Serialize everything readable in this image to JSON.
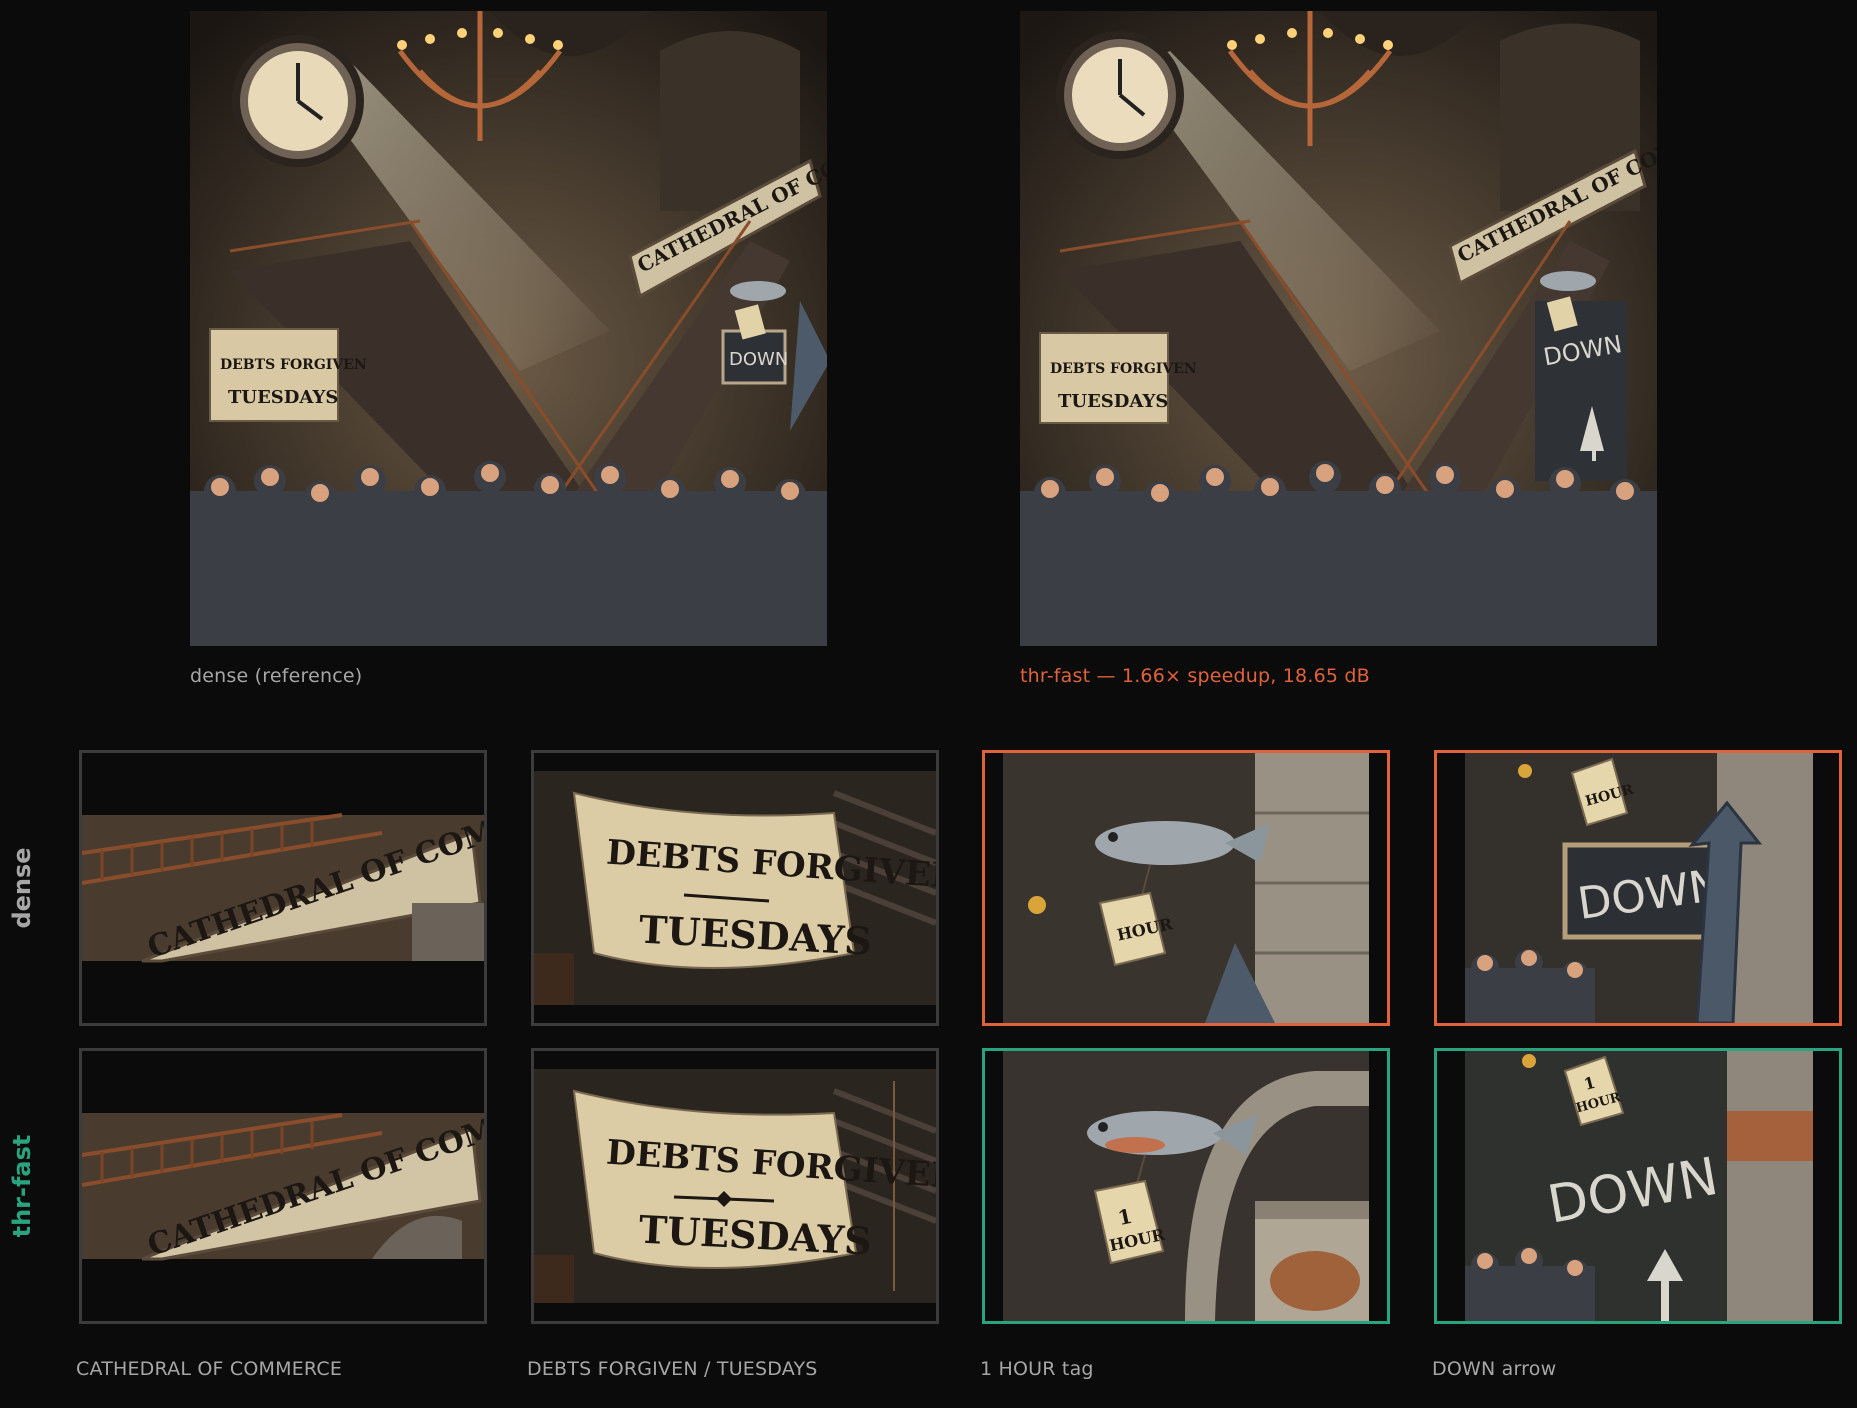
{
  "hero": {
    "left_caption": "dense (reference)",
    "right_caption": "thr-fast — 1.66× speedup, 18.65 dB"
  },
  "rows": {
    "dense": "dense",
    "thr_fast": "thr-fast"
  },
  "columns": [
    "CATHEDRAL OF COMMERCE",
    "DEBTS FORGIVEN / TUESDAYS",
    "1 HOUR tag",
    "DOWN arrow"
  ],
  "image_text": {
    "cathedral": "CATHEDRAL OF COMMERCE",
    "debts": "DEBTS FORGIVEN",
    "tuesdays": "TUESDAYS",
    "tag_number": "1",
    "tag_hour": "HOUR",
    "down": "DOWN"
  },
  "colors": {
    "background": "#0b0b0b",
    "accent_orange": "#e0623a",
    "accent_green": "#2aa37f",
    "neutral_border": "#3b3b3b",
    "caption_gray": "#a6a6a6"
  }
}
